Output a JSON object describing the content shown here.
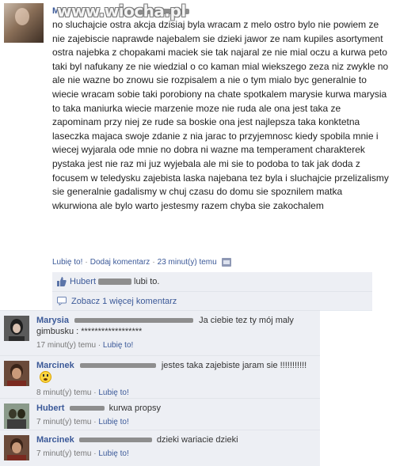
{
  "watermark": "www.wiocha.pl",
  "post": {
    "author": "Ma",
    "message": "no sluchajcie ostra akcja dzisiaj byla wracam z melo ostro bylo nie powiem ze nie zajebiscie naprawde najebalem sie dzieki jawor ze nam kupiles asortyment ostra najebka z chopakami maciek sie tak najaral ze nie mial oczu a kurwa peto taki byl nafukany ze nie wiedzial o co kaman mial wiekszego zeza niz zwykle no ale nie wazne bo znowu sie rozpisalem a nie o tym mialo byc generalnie to wiecie wracam sobie taki porobiony na chate spotkalem marysie kurwa marysia to taka maniurka wiecie marzenie moze nie ruda ale ona jest taka ze zapominam przy niej ze rude sa boskie ona jest najlepsza taka konktetna laseczka majaca swoje zdanie z nia jarac to przyjemnosc kiedy spobila mnie i wiecej wyjarala ode mnie no dobra ni wazne ma temperament charakterek pystaka jest nie raz mi juz wyjebala ale mi sie to podoba to tak jak doda z focusem w teledysku zajebista laska najebana tez byla i sluchajcie przelizalismy sie generalnie gadalismy w chuj czasu do domu sie spoznilem matka wkurwiona ale bylo warto jestesmy razem chyba sie zakochalem",
    "like_label": "Lubię to!",
    "separator": "·",
    "comment_label": "Dodaj komentarz",
    "time": "23 minut(y) temu",
    "likes_name": "Hubert",
    "likes_suffix": "lubi to.",
    "more_comments": "Zobacz 1 więcej komentarz"
  },
  "comments": [
    {
      "name": "Marysia",
      "text": "Ja ciebie tez ty mój maly gimbusku : ******************",
      "time": "17 minut(y) temu",
      "like": "Lubię to!"
    },
    {
      "name": "Marcinek",
      "text": "jestes taka zajebiste jaram sie !!!!!!!!!!!",
      "time": "8 minut(y) temu",
      "like": "Lubię to!"
    },
    {
      "name": "Hubert",
      "text": "kurwa propsy",
      "time": "7 minut(y) temu",
      "like": "Lubię to!"
    },
    {
      "name": "Marcinek",
      "text": "dzieki wariacie dzieki",
      "time": "7 minut(y) temu",
      "like": "Lubię to!"
    }
  ],
  "colors": {
    "link": "#3b5998",
    "ufi_bg": "#edeff4"
  }
}
